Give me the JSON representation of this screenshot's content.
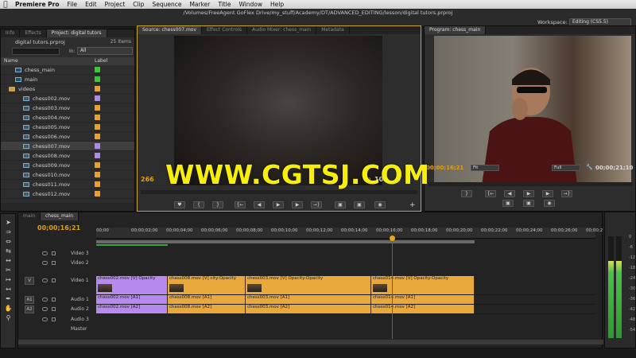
{
  "menubar": {
    "app": "Premiere Pro",
    "items": [
      "File",
      "Edit",
      "Project",
      "Clip",
      "Sequence",
      "Marker",
      "Title",
      "Window",
      "Help"
    ]
  },
  "titlebar": "/Volumes/FreeAgent GoFlex Drive/my_stuff/Academy/DT/ADVANCED_EDITING/lesson/digital tutors.prproj",
  "workspace": {
    "label": "Workspace:",
    "value": "Editing (CS5.5)"
  },
  "project_panel": {
    "tabs": [
      "Info",
      "Effects",
      "Project: digital tutors"
    ],
    "project_name": "digital tutors.prproj",
    "item_count": "25 Items",
    "in_label": "In:",
    "in_value": "All",
    "columns": [
      "Name",
      "Label"
    ],
    "rows": [
      {
        "name": "chess_main",
        "type": "seq",
        "label": "#3cc63c",
        "indent": 1
      },
      {
        "name": "main",
        "type": "seq",
        "label": "#3cc63c",
        "indent": 1
      },
      {
        "name": "videos",
        "type": "folder",
        "label": "#e9a030",
        "indent": 0
      },
      {
        "name": "chess002.mov",
        "type": "clip",
        "label": "#b08ae8",
        "indent": 2
      },
      {
        "name": "chess003.mov",
        "type": "clip",
        "label": "#e9a030",
        "indent": 2
      },
      {
        "name": "chess004.mov",
        "type": "clip",
        "label": "#e9a030",
        "indent": 2
      },
      {
        "name": "chess005.mov",
        "type": "clip",
        "label": "#e9a030",
        "indent": 2
      },
      {
        "name": "chess006.mov",
        "type": "clip",
        "label": "#e9a030",
        "indent": 2
      },
      {
        "name": "chess007.mov",
        "type": "clip",
        "label": "#b08ae8",
        "indent": 2,
        "selected": true
      },
      {
        "name": "chess008.mov",
        "type": "clip",
        "label": "#b08ae8",
        "indent": 2
      },
      {
        "name": "chess009.mov",
        "type": "clip",
        "label": "#e9a030",
        "indent": 2
      },
      {
        "name": "chess010.mov",
        "type": "clip",
        "label": "#e9a030",
        "indent": 2
      },
      {
        "name": "chess011.mov",
        "type": "clip",
        "label": "#e9a030",
        "indent": 2
      },
      {
        "name": "chess012.mov",
        "type": "clip",
        "label": "#e9a030",
        "indent": 2
      }
    ]
  },
  "source_monitor": {
    "tabs": [
      "Source: chess007.mov",
      "Effect Controls",
      "Audio Mixer: chess_main",
      "Metadata"
    ],
    "timecode_in": "266",
    "timecode_out": "103",
    "zoom": "1/2"
  },
  "program_monitor": {
    "tab": "Program: chess_main",
    "timecode": "00;00;16;21",
    "fit": "Fit",
    "quality": "Full",
    "duration": "00;00;21;10"
  },
  "timeline": {
    "tabs": [
      "main",
      "chess_main"
    ],
    "timecode": "00;00;16;21",
    "ruler_ticks": [
      "00;00",
      "00;00;02;00",
      "00;00;04;00",
      "00;00;06;00",
      "00;00;08;00",
      "00;00;10;00",
      "00;00;12;00",
      "00;00;14;00",
      "00;00;16;00",
      "00;00;18;00",
      "00;00;20;00",
      "00;00;22;00",
      "00;00;24;00",
      "00;00;26;00",
      "00;00;2"
    ],
    "tracks": {
      "video3": "Video 3",
      "video2": "Video 2",
      "video1": "Video 1",
      "audio1": "Audio 1",
      "audio2": "Audio 2",
      "audio3": "Audio 3",
      "master": "Master",
      "v_target": "V",
      "a1_target": "A1",
      "a2_target": "A2"
    },
    "video_clips": [
      {
        "label": "chess002.mov [V] Opacity",
        "selected": true
      },
      {
        "label": "chess008.mov [V] city:Opacity"
      },
      {
        "label": "chess003.mov [V] Opacity:Opacity"
      },
      {
        "label": "chess014.mov [V] Opacity:Opacity"
      }
    ],
    "audio1_clips": [
      {
        "label": "chess002.mov [A1]",
        "selected": true
      },
      {
        "label": "chess008.mov [A1]"
      },
      {
        "label": "chess003.mov [A1]"
      },
      {
        "label": "chess014.mov [A1]"
      }
    ],
    "audio2_clips": [
      {
        "label": "chess002.mov [A2]",
        "selected": true
      },
      {
        "label": "chess008.mov [A2]"
      },
      {
        "label": "chess003.mov [A2]"
      },
      {
        "label": "chess014.mov [A2]"
      }
    ]
  },
  "meters": {
    "scale": [
      "0",
      "-6",
      "-12",
      "-18",
      "-24",
      "-30",
      "-36",
      "-42",
      "-48",
      "-54"
    ]
  },
  "watermark": "WWW.CGTSJ.COM"
}
